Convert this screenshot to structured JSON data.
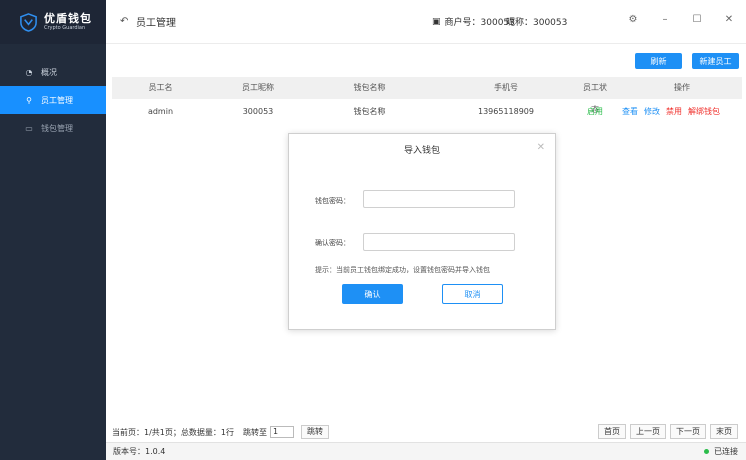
{
  "app": {
    "name": "优盾钱包",
    "subtitle": "Crypto Guardian"
  },
  "sidebar": {
    "items": [
      {
        "label": "概况",
        "icon": "pie-chart-icon"
      },
      {
        "label": "员工管理",
        "icon": "user-icon"
      },
      {
        "label": "钱包管理",
        "icon": "wallet-icon"
      }
    ]
  },
  "header": {
    "title": "员工管理",
    "merchant": "商户号：300053",
    "nickname": "昵称：300053"
  },
  "toolbar": {
    "refresh_label": "刷新",
    "new_label": "新建员工"
  },
  "table": {
    "columns": [
      "员工名",
      "员工昵称",
      "钱包名称",
      "手机号",
      "员工状态",
      "操作"
    ],
    "rows": [
      {
        "name": "admin",
        "nickname": "300053",
        "wallet": "钱包名称",
        "phone": "13965118909",
        "status": "启用",
        "ops": [
          "查看",
          "修改",
          "禁用",
          "解绑钱包"
        ]
      }
    ]
  },
  "pager": {
    "info": "当前页：1/共1页；总数据量：1行",
    "jump_label": "跳转至",
    "jump_value": "1",
    "go_label": "跳转",
    "first": "首页",
    "prev": "上一页",
    "next": "下一页",
    "last": "末页"
  },
  "status_bar": {
    "version": "版本号：1.0.4",
    "connection": "已连接"
  },
  "modal": {
    "title": "导入钱包",
    "password_label": "钱包密码：",
    "confirm_label": "确认密码：",
    "hint": "提示：当前员工钱包绑定成功，设置钱包密码并导入钱包",
    "ok_label": "确认",
    "cancel_label": "取消"
  },
  "colors": {
    "sidebar_bg": "#222c3c",
    "accent": "#1e90f5",
    "status_green": "#2bbd4b",
    "danger_red": "#f0302c"
  }
}
